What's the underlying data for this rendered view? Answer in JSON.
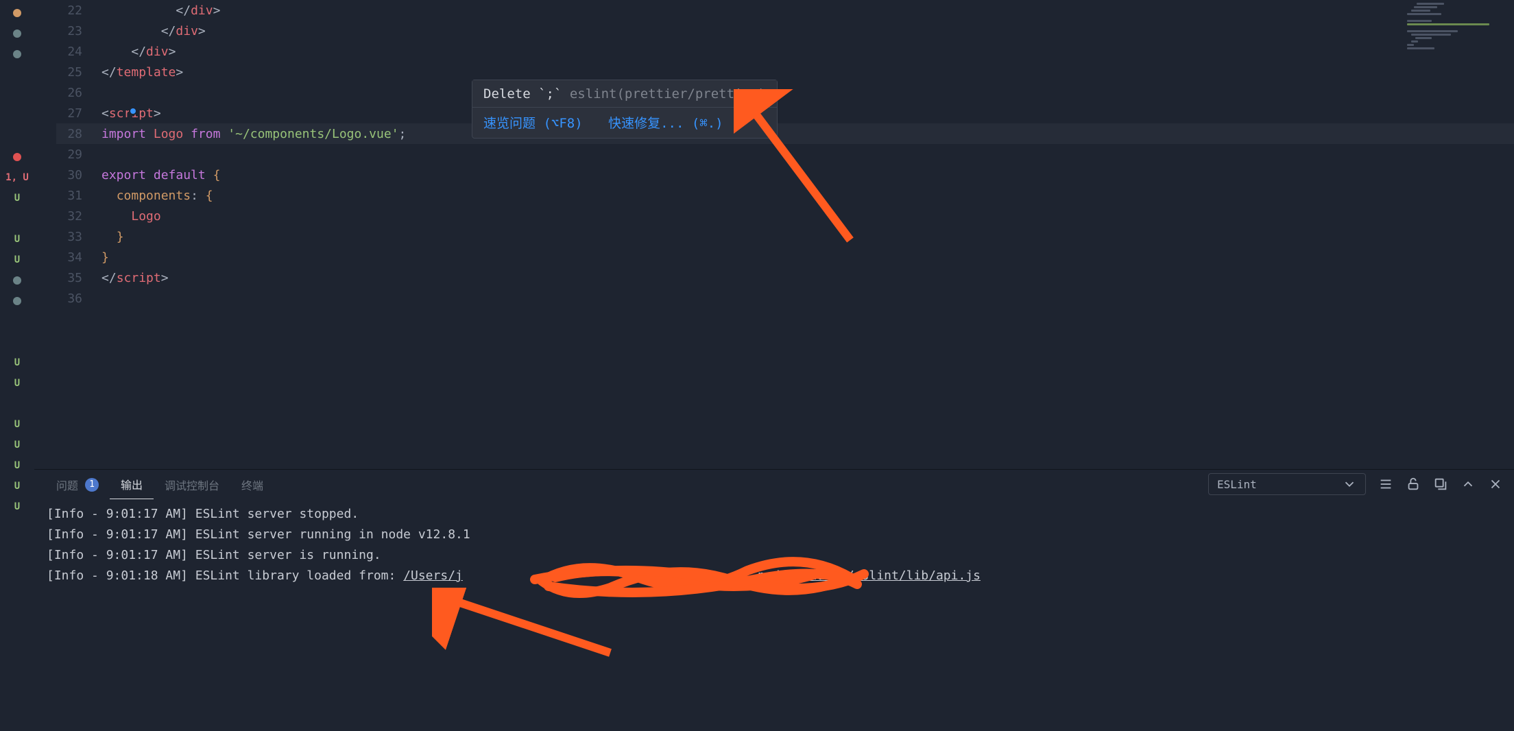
{
  "gutter": [
    {
      "kind": "dot",
      "cls": "dot-orange"
    },
    {
      "kind": "dot",
      "cls": "dot-teal"
    },
    {
      "kind": "dot",
      "cls": "dot-teal"
    },
    {
      "kind": "empty"
    },
    {
      "kind": "empty"
    },
    {
      "kind": "empty"
    },
    {
      "kind": "empty"
    },
    {
      "kind": "dot",
      "cls": "dot-red"
    },
    {
      "kind": "text",
      "text": "1, U",
      "cls": "u-red"
    },
    {
      "kind": "text",
      "text": "U",
      "cls": "u-green"
    },
    {
      "kind": "empty"
    },
    {
      "kind": "text",
      "text": "U",
      "cls": "u-green"
    },
    {
      "kind": "text",
      "text": "U",
      "cls": "u-green"
    },
    {
      "kind": "dot",
      "cls": "dot-teal"
    },
    {
      "kind": "dot",
      "cls": "dot-teal"
    },
    {
      "kind": "empty"
    },
    {
      "kind": "empty"
    },
    {
      "kind": "text",
      "text": "U",
      "cls": "u-green"
    },
    {
      "kind": "text",
      "text": "U",
      "cls": "u-green"
    },
    {
      "kind": "empty"
    },
    {
      "kind": "text",
      "text": "U",
      "cls": "u-green"
    },
    {
      "kind": "text",
      "text": "U",
      "cls": "u-green"
    },
    {
      "kind": "text",
      "text": "U",
      "cls": "u-green"
    },
    {
      "kind": "text",
      "text": "U",
      "cls": "u-green"
    },
    {
      "kind": "text",
      "text": "U",
      "cls": "u-green"
    }
  ],
  "lines": [
    {
      "n": "22",
      "segs": [
        {
          "t": "          ",
          "c": ""
        },
        {
          "t": "</",
          "c": "punct"
        },
        {
          "t": "div",
          "c": "tag"
        },
        {
          "t": ">",
          "c": "punct"
        }
      ]
    },
    {
      "n": "23",
      "segs": [
        {
          "t": "        ",
          "c": ""
        },
        {
          "t": "</",
          "c": "punct"
        },
        {
          "t": "div",
          "c": "tag"
        },
        {
          "t": ">",
          "c": "punct"
        }
      ]
    },
    {
      "n": "24",
      "segs": [
        {
          "t": "    ",
          "c": ""
        },
        {
          "t": "</",
          "c": "punct"
        },
        {
          "t": "div",
          "c": "tag"
        },
        {
          "t": ">",
          "c": "punct"
        }
      ]
    },
    {
      "n": "25",
      "segs": [
        {
          "t": "</",
          "c": "punct"
        },
        {
          "t": "template",
          "c": "tag"
        },
        {
          "t": ">",
          "c": "punct"
        }
      ]
    },
    {
      "n": "26",
      "segs": []
    },
    {
      "n": "27",
      "segs": [
        {
          "t": "<",
          "c": "punct"
        },
        {
          "t": "script",
          "c": "tag"
        },
        {
          "t": ">",
          "c": "punct"
        }
      ],
      "dot": true
    },
    {
      "n": "28",
      "hl": true,
      "segs": [
        {
          "t": "import",
          "c": "kw"
        },
        {
          "t": " ",
          "c": ""
        },
        {
          "t": "Logo",
          "c": "cls"
        },
        {
          "t": " ",
          "c": ""
        },
        {
          "t": "from",
          "c": "kw"
        },
        {
          "t": " ",
          "c": ""
        },
        {
          "t": "'~/components/Logo.vue'",
          "c": "str"
        },
        {
          "t": ";",
          "c": "punct"
        }
      ]
    },
    {
      "n": "29",
      "segs": []
    },
    {
      "n": "30",
      "segs": [
        {
          "t": "export",
          "c": "kw"
        },
        {
          "t": " ",
          "c": ""
        },
        {
          "t": "default",
          "c": "kw"
        },
        {
          "t": " ",
          "c": ""
        },
        {
          "t": "{",
          "c": "brace"
        }
      ]
    },
    {
      "n": "31",
      "segs": [
        {
          "t": "  ",
          "c": ""
        },
        {
          "t": "components",
          "c": "prop2"
        },
        {
          "t": ": ",
          "c": "punct"
        },
        {
          "t": "{",
          "c": "brace"
        }
      ]
    },
    {
      "n": "32",
      "segs": [
        {
          "t": "    ",
          "c": ""
        },
        {
          "t": "Logo",
          "c": "cls"
        }
      ]
    },
    {
      "n": "33",
      "segs": [
        {
          "t": "  ",
          "c": ""
        },
        {
          "t": "}",
          "c": "brace"
        }
      ]
    },
    {
      "n": "34",
      "segs": [
        {
          "t": "}",
          "c": "brace"
        }
      ]
    },
    {
      "n": "35",
      "segs": [
        {
          "t": "</",
          "c": "punct"
        },
        {
          "t": "script",
          "c": "tag"
        },
        {
          "t": ">",
          "c": "punct"
        }
      ]
    },
    {
      "n": "36",
      "segs": []
    }
  ],
  "hover": {
    "msg_prefix": "Delete `;`",
    "msg_rule": " eslint(prettier/prettier)",
    "peek": "速览问题 (⌥F8)",
    "fix": "快速修复... (⌘.)"
  },
  "panel": {
    "tabs": {
      "problems": "问题",
      "problems_count": "1",
      "output": "输出",
      "debug": "调试控制台",
      "terminal": "终端"
    },
    "channel": "ESLint",
    "log": [
      "[Info  - 9:01:17 AM] ESLint server stopped.",
      "[Info  - 9:01:17 AM] ESLint server running in node v12.8.1",
      "[Info  - 9:01:17 AM] ESLint server is running.",
      "[Info  - 9:01:18 AM] ESLint library loaded from: "
    ],
    "log_path_left": "/Users/j",
    "log_path_right": "node_modules/eslint/lib/api.js"
  }
}
